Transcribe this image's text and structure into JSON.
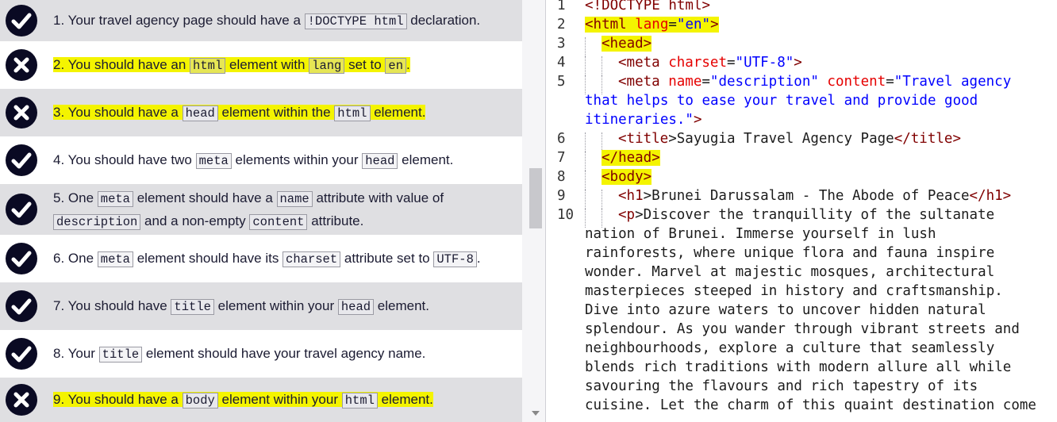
{
  "tests": [
    {
      "state": "pass",
      "highlight": false,
      "parts": [
        {
          "t": "1. Your travel agency page should have a "
        },
        {
          "c": "!DOCTYPE html"
        },
        {
          "t": " declaration."
        }
      ]
    },
    {
      "state": "fail",
      "highlight": true,
      "parts": [
        {
          "t": "2. You should have an "
        },
        {
          "c": "html"
        },
        {
          "t": " element with "
        },
        {
          "c": "lang"
        },
        {
          "t": " set to "
        },
        {
          "c": "en"
        },
        {
          "t": "."
        }
      ]
    },
    {
      "state": "fail",
      "highlight": true,
      "parts": [
        {
          "t": "3. You should have a "
        },
        {
          "c": "head"
        },
        {
          "t": " element within the "
        },
        {
          "c": "html"
        },
        {
          "t": " element."
        }
      ]
    },
    {
      "state": "pass",
      "highlight": false,
      "parts": [
        {
          "t": "4. You should have two "
        },
        {
          "c": "meta"
        },
        {
          "t": " elements within your "
        },
        {
          "c": "head"
        },
        {
          "t": " element."
        }
      ]
    },
    {
      "state": "pass",
      "highlight": false,
      "parts": [
        {
          "t": "5. One "
        },
        {
          "c": "meta"
        },
        {
          "t": " element should have a "
        },
        {
          "c": "name"
        },
        {
          "t": " attribute with value of "
        },
        {
          "c": "description"
        },
        {
          "t": " and a non-empty "
        },
        {
          "c": "content"
        },
        {
          "t": " attribute."
        }
      ]
    },
    {
      "state": "pass",
      "highlight": false,
      "parts": [
        {
          "t": "6. One "
        },
        {
          "c": "meta"
        },
        {
          "t": " element should have its "
        },
        {
          "c": "charset"
        },
        {
          "t": " attribute set to "
        },
        {
          "c": "UTF-8"
        },
        {
          "t": "."
        }
      ]
    },
    {
      "state": "pass",
      "highlight": false,
      "parts": [
        {
          "t": "7. You should have "
        },
        {
          "c": "title"
        },
        {
          "t": " element within your "
        },
        {
          "c": "head"
        },
        {
          "t": " element."
        }
      ]
    },
    {
      "state": "pass",
      "highlight": false,
      "parts": [
        {
          "t": "8. Your "
        },
        {
          "c": "title"
        },
        {
          "t": " element should have your travel agency name."
        }
      ]
    },
    {
      "state": "fail",
      "highlight": true,
      "parts": [
        {
          "t": "9. You should have a "
        },
        {
          "c": "body"
        },
        {
          "t": " element within your "
        },
        {
          "c": "html"
        },
        {
          "t": " element."
        }
      ]
    }
  ],
  "code_lines": [
    {
      "n": "1",
      "indent": 0,
      "spans": [
        {
          "k": "tag",
          "t": "<!DOCTYPE html>"
        }
      ]
    },
    {
      "n": "2",
      "indent": 0,
      "spans": [
        {
          "k": "tag",
          "t": "<html",
          "hl": true
        },
        {
          "k": "attr",
          "t": " lang",
          "hl": true
        },
        {
          "k": "plain",
          "t": "=",
          "hl": true
        },
        {
          "k": "val",
          "t": "\"en\"",
          "hl": true
        },
        {
          "k": "tag",
          "t": ">",
          "hl": true
        }
      ]
    },
    {
      "n": "3",
      "indent": 1,
      "spans": [
        {
          "k": "tag",
          "t": "<head>",
          "hl": true
        }
      ]
    },
    {
      "n": "4",
      "indent": 2,
      "spans": [
        {
          "k": "tag",
          "t": "<meta"
        },
        {
          "k": "attr",
          "t": " charset"
        },
        {
          "k": "plain",
          "t": "="
        },
        {
          "k": "val",
          "t": "\"UTF-8\""
        },
        {
          "k": "tag",
          "t": ">"
        }
      ]
    },
    {
      "n": "5",
      "indent": 2,
      "spans": [
        {
          "k": "tag",
          "t": "<meta"
        },
        {
          "k": "attr",
          "t": " name"
        },
        {
          "k": "plain",
          "t": "="
        },
        {
          "k": "val",
          "t": "\"description\""
        },
        {
          "k": "attr",
          "t": " content"
        },
        {
          "k": "plain",
          "t": "="
        },
        {
          "k": "val",
          "t": "\"Travel agency"
        }
      ]
    },
    {
      "n": "",
      "indent": 0,
      "spans": [
        {
          "k": "val",
          "t": "that helps to ease your travel and provide good"
        }
      ]
    },
    {
      "n": "",
      "indent": 0,
      "spans": [
        {
          "k": "val",
          "t": "itineraries.\""
        },
        {
          "k": "tag",
          "t": ">"
        }
      ]
    },
    {
      "n": "6",
      "indent": 2,
      "spans": [
        {
          "k": "tag",
          "t": "<title"
        },
        {
          "k": "plain",
          "t": ">Sayugia Travel Agency Page"
        },
        {
          "k": "tag",
          "t": "</title>"
        }
      ]
    },
    {
      "n": "7",
      "indent": 1,
      "spans": [
        {
          "k": "tag",
          "t": "</head>",
          "hl": true
        }
      ]
    },
    {
      "n": "8",
      "indent": 1,
      "spans": [
        {
          "k": "tag",
          "t": "<body>",
          "hl": true
        }
      ]
    },
    {
      "n": "9",
      "indent": 2,
      "spans": [
        {
          "k": "tag",
          "t": "<h1"
        },
        {
          "k": "plain",
          "t": ">Brunei Darussalam - The Abode of Peace"
        },
        {
          "k": "tag",
          "t": "</h1>"
        }
      ]
    },
    {
      "n": "10",
      "indent": 2,
      "spans": [
        {
          "k": "tag",
          "t": "<p"
        },
        {
          "k": "plain",
          "t": ">Discover the tranquillity of the sultanate"
        }
      ]
    },
    {
      "n": "",
      "indent": 0,
      "spans": [
        {
          "k": "plain",
          "t": "nation of Brunei. Immerse yourself in lush"
        }
      ]
    },
    {
      "n": "",
      "indent": 0,
      "spans": [
        {
          "k": "plain",
          "t": "rainforests, where unique flora and fauna inspire"
        }
      ]
    },
    {
      "n": "",
      "indent": 0,
      "spans": [
        {
          "k": "plain",
          "t": "wonder. Marvel at majestic mosques, architectural"
        }
      ]
    },
    {
      "n": "",
      "indent": 0,
      "spans": [
        {
          "k": "plain",
          "t": "masterpieces steeped in history and craftsmanship."
        }
      ]
    },
    {
      "n": "",
      "indent": 0,
      "spans": [
        {
          "k": "plain",
          "t": "Dive into azure waters to uncover hidden natural"
        }
      ]
    },
    {
      "n": "",
      "indent": 0,
      "spans": [
        {
          "k": "plain",
          "t": "splendour. As you wander through vibrant streets and"
        }
      ]
    },
    {
      "n": "",
      "indent": 0,
      "spans": [
        {
          "k": "plain",
          "t": "neighbourhoods, explore a culture that seamlessly"
        }
      ]
    },
    {
      "n": "",
      "indent": 0,
      "spans": [
        {
          "k": "plain",
          "t": "blends rich traditions with modern allure all while"
        }
      ]
    },
    {
      "n": "",
      "indent": 0,
      "spans": [
        {
          "k": "plain",
          "t": "savouring the flavours and rich tapestry of its"
        }
      ]
    },
    {
      "n": "",
      "indent": 0,
      "spans": [
        {
          "k": "plain",
          "t": "cuisine. Let the charm of this quaint destination come"
        }
      ]
    }
  ]
}
